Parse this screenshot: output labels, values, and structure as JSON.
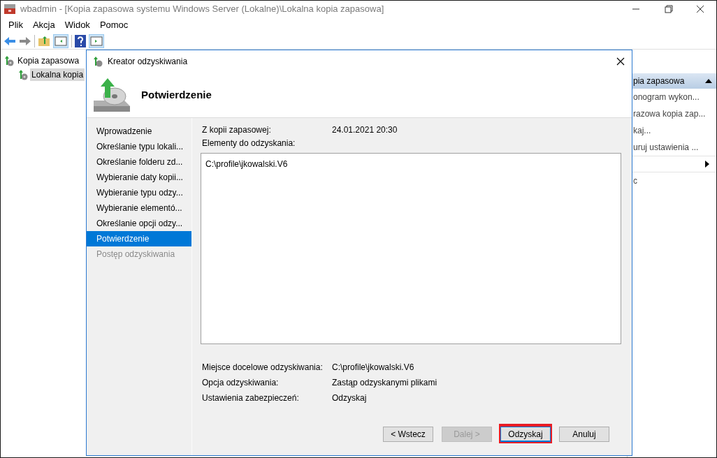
{
  "window": {
    "title": "wbadmin - [Kopia zapasowa systemu Windows Server (Lokalne)\\Lokalna kopia zapasowa]"
  },
  "menu": [
    "Plik",
    "Akcja",
    "Widok",
    "Pomoc"
  ],
  "tree": [
    {
      "label": "Kopia zapasowa",
      "selected": false,
      "children": [
        {
          "label": "Lokalna kopia",
          "selected": true
        }
      ]
    }
  ],
  "actions": {
    "header": "pia zapasowa",
    "items": [
      {
        "label": "onogram wykon...",
        "kind": "action"
      },
      {
        "label": "razowa kopia zap...",
        "kind": "action"
      },
      {
        "label": "kaj...",
        "kind": "action"
      },
      {
        "label": "uruj ustawienia ...",
        "kind": "action"
      },
      {
        "kind": "submenu"
      },
      {
        "label": "c",
        "kind": "action"
      }
    ]
  },
  "dialog": {
    "title": "Kreator odzyskiwania",
    "heading": "Potwierdzenie",
    "steps": [
      {
        "label": "Wprowadzenie",
        "selected": false,
        "disabled": false
      },
      {
        "label": "Określanie typu lokali...",
        "selected": false,
        "disabled": false
      },
      {
        "label": "Określanie folderu zd...",
        "selected": false,
        "disabled": false
      },
      {
        "label": "Wybieranie daty kopii...",
        "selected": false,
        "disabled": false
      },
      {
        "label": "Wybieranie typu odzy...",
        "selected": false,
        "disabled": false
      },
      {
        "label": "Wybieranie elementó...",
        "selected": false,
        "disabled": false
      },
      {
        "label": "Określanie opcji odzy...",
        "selected": false,
        "disabled": false
      },
      {
        "label": "Potwierdzenie",
        "selected": true,
        "disabled": false
      },
      {
        "label": "Postęp odzyskiwania",
        "selected": false,
        "disabled": true
      }
    ],
    "source": {
      "label": "Z kopii zapasowej:",
      "value": "24.01.2021 20:30"
    },
    "items_label": "Elementy do odzyskania:",
    "items": [
      "C:\\profile\\jkowalski.V6"
    ],
    "details": [
      {
        "label": "Miejsce docelowe odzyskiwania:",
        "value": "C:\\profile\\jkowalski.V6"
      },
      {
        "label": "Opcja odzyskiwania:",
        "value": "Zastąp odzyskanymi plikami"
      },
      {
        "label": "Ustawienia zabezpieczeń:",
        "value": "Odzyskaj"
      }
    ],
    "buttons": [
      {
        "label": "< Wstecz",
        "disabled": false,
        "highlighted": false
      },
      {
        "label": "Dalej >",
        "disabled": true,
        "highlighted": false
      },
      {
        "label": "Odzyskaj",
        "disabled": false,
        "highlighted": true
      },
      {
        "label": "Anuluj",
        "disabled": false,
        "highlighted": false
      }
    ]
  }
}
